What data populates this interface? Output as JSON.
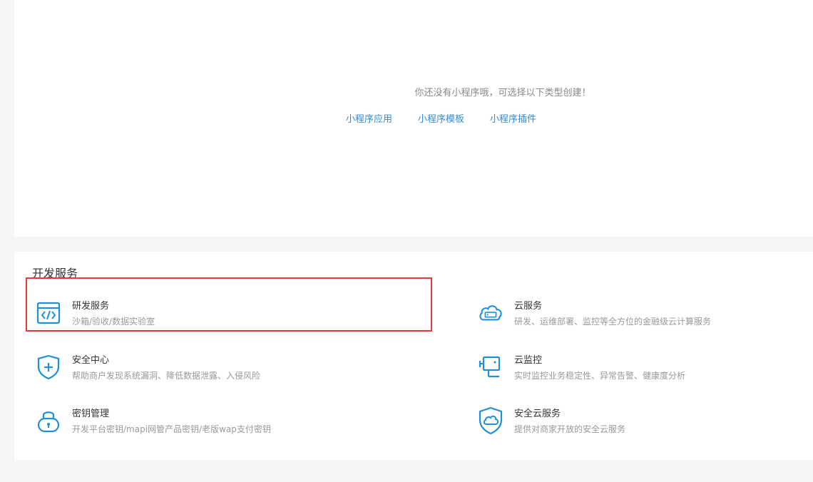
{
  "empty_state": {
    "message": "你还没有小程序哦，可选择以下类型创建！",
    "links": [
      {
        "label": "小程序应用"
      },
      {
        "label": "小程序模板"
      },
      {
        "label": "小程序插件"
      }
    ]
  },
  "dev_services": {
    "title": "开发服务",
    "items": [
      {
        "name": "研发服务",
        "desc": "沙箱/验收/数据实验室",
        "icon": "code-window-icon"
      },
      {
        "name": "云服务",
        "desc": "研发、运维部署、监控等全方位的金融级云计算服务",
        "icon": "cloud-server-icon"
      },
      {
        "name": "安全中心",
        "desc": "帮助商户发现系统漏洞、降低数据泄露、入侵风险",
        "icon": "shield-plus-icon"
      },
      {
        "name": "云监控",
        "desc": "实时监控业务稳定性、异常告警、健康度分析",
        "icon": "security-camera-icon"
      },
      {
        "name": "密钥管理",
        "desc": "开发平台密钥/mapi网管产品密钥/老版wap支付密钥",
        "icon": "lock-icon"
      },
      {
        "name": "安全云服务",
        "desc": "提供对商家开放的安全云服务",
        "icon": "shield-cloud-icon"
      }
    ]
  },
  "colors": {
    "accent": "#2f8bd6",
    "icon": "#1e8fd8",
    "highlight": "#e0393e"
  }
}
